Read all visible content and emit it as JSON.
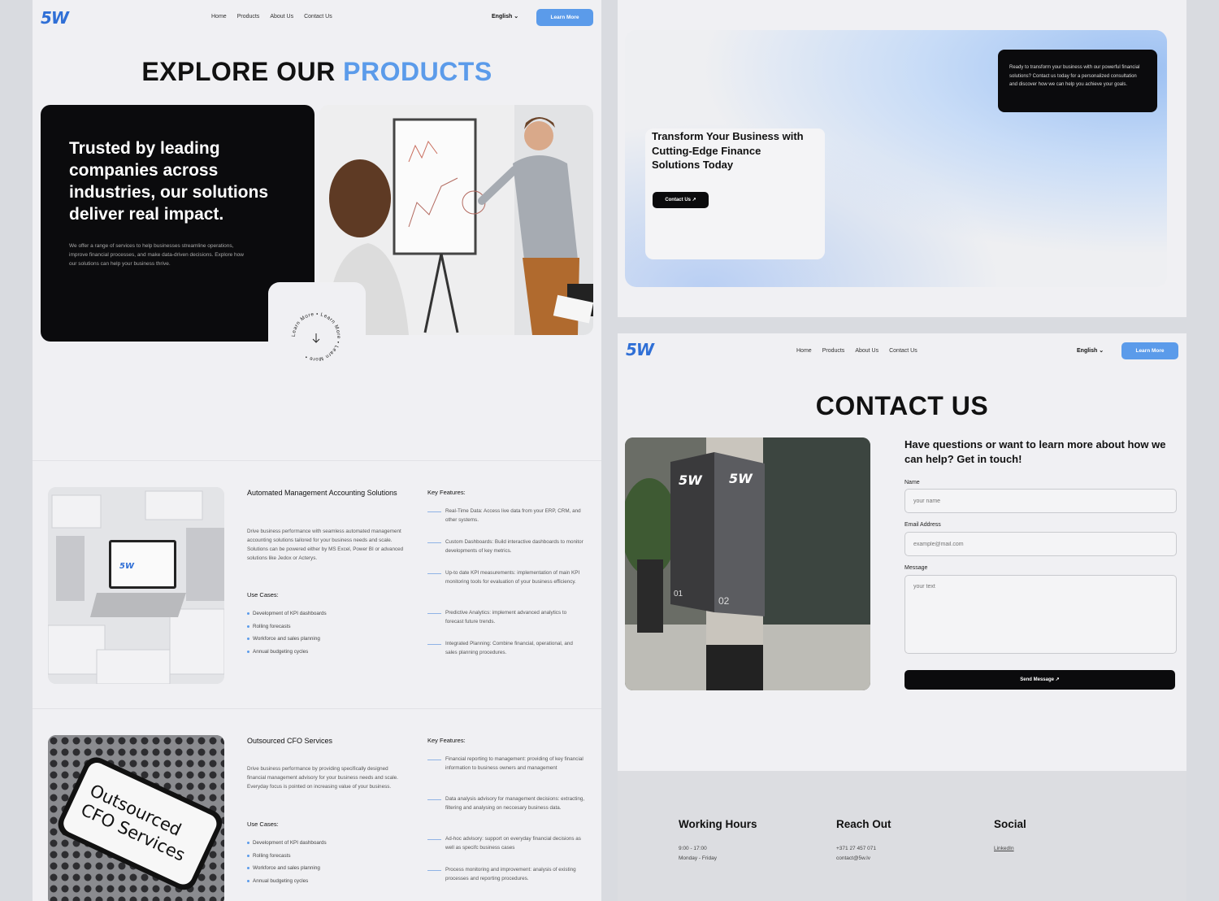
{
  "nav": {
    "logo": "5W",
    "links": [
      "Home",
      "Products",
      "About Us",
      "Contact Us"
    ],
    "language": "English",
    "cta": "Learn More"
  },
  "products_page": {
    "title_part1": "EXPLORE OUR",
    "title_part2": "PRODUCTS",
    "hero_title": "Trusted by leading companies across industries, our solutions deliver real impact.",
    "hero_desc": "We offer a range of services to help businesses streamline operations, improve financial processes, and make data-driven decisions. Explore how our solutions can help your business thrive.",
    "circle_text": "Learn More • Learn More • Learn More •",
    "products": [
      {
        "title": "Automated Management Accounting Solutions",
        "desc": "Drive business performance with seamless automated management accounting solutions tailored for your business needs and scale. Solutions can be powered either by MS Excel, Power BI or advanced solutions like Jedox or Acterys.",
        "use_cases_title": "Use Cases:",
        "use_cases": [
          "Development of KPI dashboards",
          "Rolling forecasts",
          "Workforce and sales planning",
          "Annual budgeting cycles"
        ],
        "features_title": "Key Features:",
        "features": [
          "Real-Time Data: Access live data from your ERP, CRM, and other systems.",
          "Custom Dashboards: Build interactive dashboards to monitor developments of key metrics.",
          "Up-to date KPI measurements: implementation of main KPI monitoring tools for evaluation of your business efficiency.",
          "Predictive Analytics: implement advanced analytics to forecast future trends.",
          "Integrated Planning: Combine financial, operational, and sales planning procedures."
        ],
        "laptop_logo": "5W"
      },
      {
        "title": "Outsourced CFO Services",
        "desc": "Drive business performance by providing specifically designed financial management advisory for your business needs and scale. Everyday focus is pointed on increasing value of your business.",
        "use_cases_title": "Use Cases:",
        "use_cases": [
          "Development of KPI dashboards",
          "Rolling forecasts",
          "Workforce and sales planning",
          "Annual budgeting cycles"
        ],
        "features_title": "Key Features:",
        "features": [
          "Financial reporting to management: providing of key financial information to business owners and management",
          "Data analysis advisory for management decisions: extracting, filtering and analysing on neccesary business data.",
          "Ad-hoc advisory: support on everyday financial decisions as well as specifc business cases",
          "Process monitoring and improvement: analysis of existing processes and reporting procedures."
        ],
        "phone_text": "Outsourced CFO Services"
      }
    ]
  },
  "cta_section": {
    "title": "Transform Your Business with Cutting-Edge Finance Solutions Today",
    "button": "Contact Us ↗",
    "note": "Ready to transform your business with our powerful financial solutions? Contact us today for a personalized consultation and discover how we can help you achieve your goals."
  },
  "contact_page": {
    "title": "CONTACT US",
    "heading": "Have questions or want to learn more about how we can help? Get in touch!",
    "name_label": "Name",
    "name_placeholder": "your name",
    "email_label": "Email Address",
    "email_placeholder": "example@mail.com",
    "message_label": "Message",
    "message_placeholder": "your text",
    "send": "Send Message ↗",
    "sign_logo": "5W",
    "sign_numbers": [
      "01",
      "02"
    ]
  },
  "footer": {
    "hours_title": "Working Hours",
    "hours": [
      "9:00 - 17:00",
      "Monday - Friday"
    ],
    "reach_title": "Reach Out",
    "reach": [
      "+371 27 457 071",
      "contact@5w.lv"
    ],
    "social_title": "Social",
    "social_link": "LinkedIn"
  },
  "colors": {
    "accent": "#5b9bea",
    "dark": "#0b0b0d",
    "bg": "#f0f0f3"
  }
}
